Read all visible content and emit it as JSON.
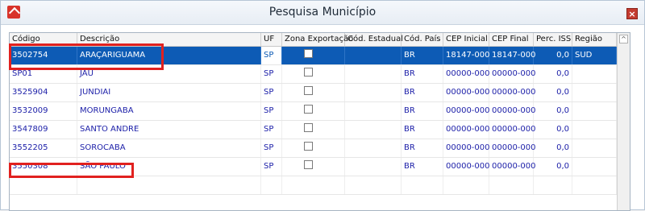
{
  "window": {
    "title": "Pesquisa Município",
    "close_label": "×"
  },
  "grid": {
    "columns": [
      "Código",
      "Descrição",
      "UF",
      "Zona Exportação",
      "Cód. Estadual",
      "Cód. País",
      "CEP Inicial",
      "CEP Final",
      "Perc. ISS",
      "Região"
    ],
    "rows": [
      {
        "codigo": "3502754",
        "descricao": "ARAÇARIGUAMA",
        "uf": "SP",
        "zona": false,
        "cod_estadual": "",
        "cod_pais": "BR",
        "cep_inicial": "18147-000",
        "cep_final": "18147-000",
        "perc_iss": "0,0",
        "regiao": "SUD",
        "selected": true
      },
      {
        "codigo": "SP01",
        "descricao": "JAÚ",
        "uf": "SP",
        "zona": false,
        "cod_estadual": "",
        "cod_pais": "BR",
        "cep_inicial": "00000-000",
        "cep_final": "00000-000",
        "perc_iss": "0,0",
        "regiao": ""
      },
      {
        "codigo": "3525904",
        "descricao": "JUNDIAI",
        "uf": "SP",
        "zona": false,
        "cod_estadual": "",
        "cod_pais": "BR",
        "cep_inicial": "00000-000",
        "cep_final": "00000-000",
        "perc_iss": "0,0",
        "regiao": ""
      },
      {
        "codigo": "3532009",
        "descricao": "MORUNGABA",
        "uf": "SP",
        "zona": false,
        "cod_estadual": "",
        "cod_pais": "BR",
        "cep_inicial": "00000-000",
        "cep_final": "00000-000",
        "perc_iss": "0,0",
        "regiao": ""
      },
      {
        "codigo": "3547809",
        "descricao": "SANTO ANDRE",
        "uf": "SP",
        "zona": false,
        "cod_estadual": "",
        "cod_pais": "BR",
        "cep_inicial": "00000-000",
        "cep_final": "00000-000",
        "perc_iss": "0,0",
        "regiao": ""
      },
      {
        "codigo": "3552205",
        "descricao": "SOROCABA",
        "uf": "SP",
        "zona": false,
        "cod_estadual": "",
        "cod_pais": "BR",
        "cep_inicial": "00000-000",
        "cep_final": "00000-000",
        "perc_iss": "0,0",
        "regiao": ""
      },
      {
        "codigo": "3550308",
        "descricao": "SÃO PAULO",
        "uf": "SP",
        "zona": false,
        "cod_estadual": "",
        "cod_pais": "BR",
        "cep_inicial": "00000-000",
        "cep_final": "00000-000",
        "perc_iss": "0,0",
        "regiao": ""
      }
    ]
  },
  "colors": {
    "selected_row": "#0d5bb5",
    "row_text": "#1b1ea8",
    "highlight": "#e1211f"
  }
}
